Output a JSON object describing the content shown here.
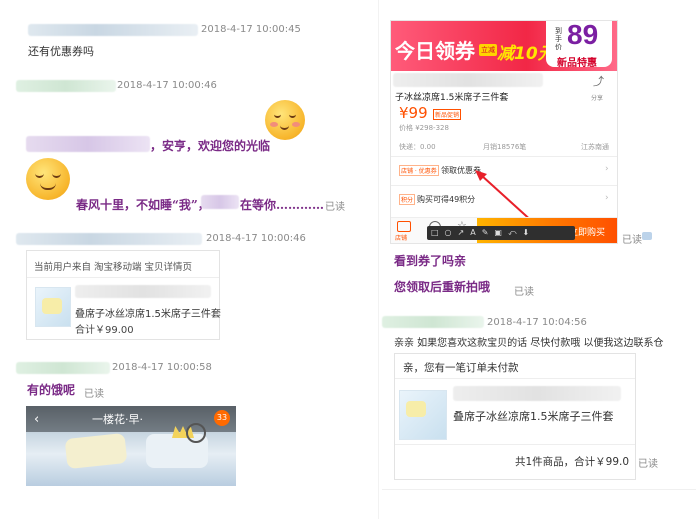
{
  "left": {
    "msg1": {
      "timestamp": "2018-4-17 10:00:45",
      "text": "还有优惠券吗"
    },
    "msg2": {
      "timestamp": "2018-4-17 10:00:46",
      "greeting": "，安亨，欢迎您的光临",
      "line2_a": "春风十里，不如睡“我”，",
      "line2_b": "在等你…………",
      "read": "已读"
    },
    "msg3": {
      "timestamp": "2018-4-17 10:00:46",
      "card_header": "当前用户来自 淘宝移动端 宝贝详情页",
      "product_name": "叠席子冰丝凉席1.5米席子三件套",
      "total": "合计￥99.00"
    },
    "msg4": {
      "timestamp": "2018-4-17 10:00:58",
      "text": "有的饿呢",
      "read": "已读",
      "image_caption": "一楼花·早·",
      "image_badge": "33"
    }
  },
  "right": {
    "screenshot": {
      "banner_main": "今日领券",
      "banner_tag": "立减",
      "banner_amount": "减10元",
      "banner_price_label": "到手价",
      "banner_price": "89",
      "banner_sub": "新品特惠",
      "product_title": "子冰丝凉席1.5米席子三件套",
      "share_label": "分享",
      "price": "¥99",
      "price_badge": "新品促销",
      "original_price": "价格 ¥298-328",
      "express": "快递：0.00",
      "monthly_sales": "月销18576笔",
      "location": "江苏南通",
      "coupon_tag": "店铺 · 优惠券",
      "coupon_text": "领取优惠券",
      "points_tag": "积分",
      "points_text": "购买可得49积分",
      "shop_label": "店铺",
      "buy_label": "立即购买",
      "read": "已读"
    },
    "msg5": {
      "text": "看到券了吗亲"
    },
    "msg6": {
      "text": "您领取后重新拍哦",
      "read": "已读"
    },
    "msg7": {
      "timestamp": "2018-4-17 10:04:56",
      "text": "亲亲 如果您喜欢这款宝贝的话 尽快付款哦 以便我这边联系仓",
      "card_header": "亲，您有一笔订单未付款",
      "product_name": "叠席子冰丝凉席1.5米席子三件套",
      "summary": "共1件商品，合计￥99.0",
      "read": "已读"
    }
  },
  "colors": {
    "accent_purple": "#7a2a86",
    "taobao_orange": "#ff5000",
    "banner_red": "#ef1f3c"
  }
}
